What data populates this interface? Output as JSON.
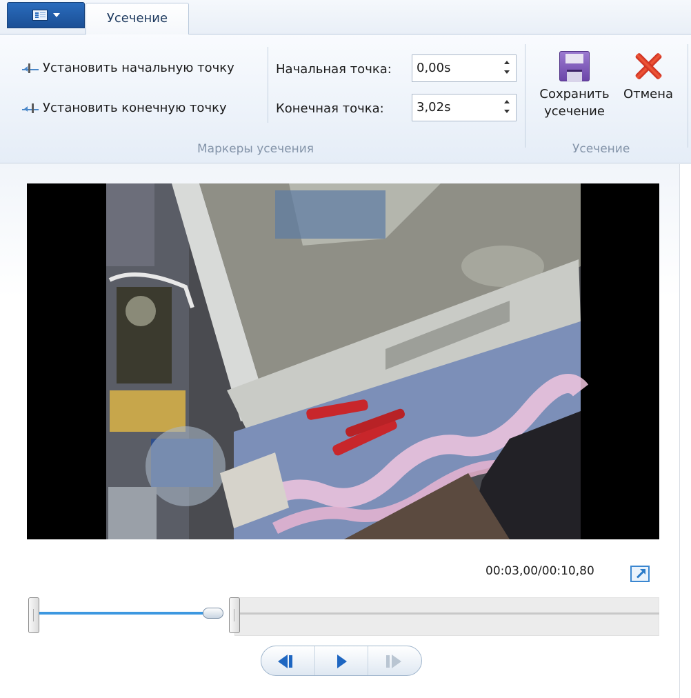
{
  "ribbon": {
    "tab_label": "Усечение",
    "set_start_label": "Установить начальную точку",
    "set_end_label": "Установить конечную точку",
    "start_point_label": "Начальная точка:",
    "start_point_value": "0,00s",
    "end_point_label": "Конечная точка:",
    "end_point_value": "3,02s",
    "markers_group_label": "Маркеры усечения",
    "save_label_line1": "Сохранить",
    "save_label_line2": "усечение",
    "cancel_label": "Отмена",
    "trim_group_label": "Усечение"
  },
  "player": {
    "timecode": "00:03,00/00:10,80",
    "position_fraction": 0.28,
    "trim_start_fraction": 0.0,
    "trim_end_fraction": 0.28
  },
  "colors": {
    "accent": "#3d98e0",
    "app_button": "#1b4f95",
    "cancel_red": "#e0402a",
    "save_purple": "#7a55b8"
  }
}
